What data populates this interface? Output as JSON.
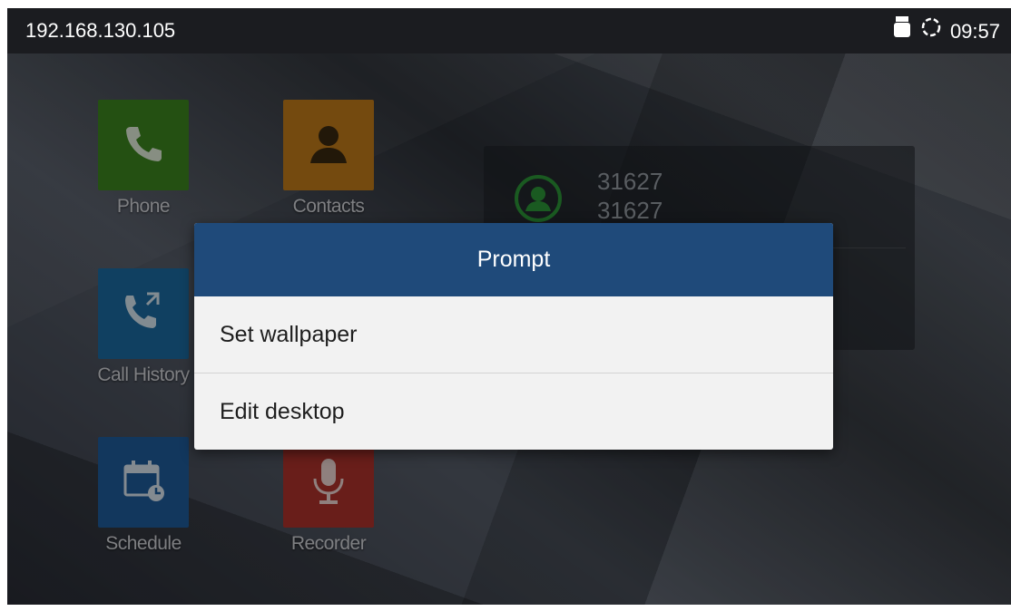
{
  "status_bar": {
    "ip": "192.168.130.105",
    "time": "09:57",
    "icons": [
      "usb-icon",
      "sync-icon"
    ]
  },
  "apps": [
    {
      "label": "Phone",
      "icon": "phone-icon",
      "color": "#3f8a1f"
    },
    {
      "label": "Contacts",
      "icon": "person-icon",
      "color": "#c9801a"
    },
    {
      "label": "Call History",
      "icon": "call-history-icon",
      "color": "#1c6fa8"
    },
    {
      "label": "Schedule",
      "icon": "calendar-icon",
      "color": "#1f5fa0"
    },
    {
      "label": "Recorder",
      "icon": "microphone-icon",
      "color": "#b5352e"
    }
  ],
  "widget": {
    "account_number": "31627",
    "account_name": "31627",
    "icon": "account-icon",
    "accent": "#2e9b3a"
  },
  "dialog": {
    "title": "Prompt",
    "options": [
      "Set wallpaper",
      "Edit desktop"
    ],
    "header_color": "#1f4a7a"
  }
}
